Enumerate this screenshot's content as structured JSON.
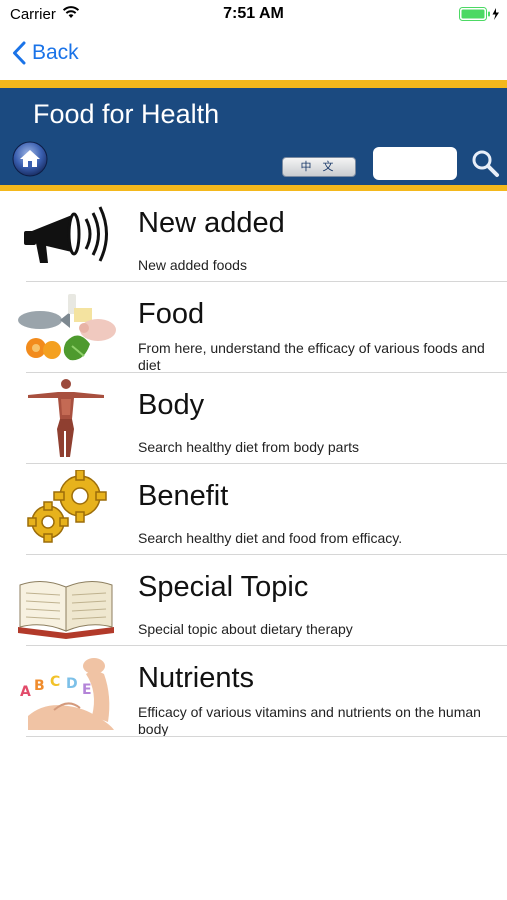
{
  "status_bar": {
    "carrier": "Carrier",
    "time": "7:51 AM"
  },
  "nav": {
    "back_label": "Back"
  },
  "header": {
    "title": "Food for Health",
    "language_button": "中 文",
    "search_placeholder": ""
  },
  "icons": {
    "back": "chevron-left-icon",
    "home": "home-icon",
    "search": "magnifier-icon",
    "wifi": "wifi-icon",
    "battery": "battery-icon"
  },
  "colors": {
    "header_blue": "#1b4a80",
    "accent_gold": "#f4b81c",
    "link_blue": "#1a73e8",
    "battery_green": "#4cd964"
  },
  "menu": [
    {
      "title": "New added",
      "description": "New added foods",
      "thumbnail": "megaphone-icon"
    },
    {
      "title": "Food",
      "description": "From here, understand the efficacy of various foods and diet",
      "thumbnail": "food-assortment-image"
    },
    {
      "title": "Body",
      "description": "Search healthy diet from body parts",
      "thumbnail": "human-body-image"
    },
    {
      "title": "Benefit",
      "description": "Search healthy diet and food from efficacy.",
      "thumbnail": "gears-icon"
    },
    {
      "title": "Special Topic",
      "description": "Special topic about dietary therapy",
      "thumbnail": "open-book-image"
    },
    {
      "title": "Nutrients",
      "description": "Efficacy of various vitamins and nutrients on the human body",
      "thumbnail": "vitamin-arm-image"
    }
  ]
}
